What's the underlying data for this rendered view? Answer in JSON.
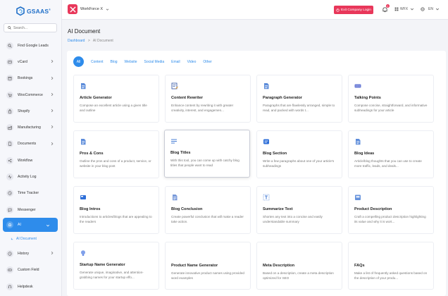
{
  "brand": {
    "name": "GSAAS",
    "mark": "®"
  },
  "search": {
    "placeholder": "Search..."
  },
  "sidebar": {
    "items": [
      {
        "label": "Find Google Leads",
        "icon": "search-icon",
        "chevron": false
      },
      {
        "label": "vCard",
        "icon": "card-icon",
        "chevron": true
      },
      {
        "label": "Bookings",
        "icon": "calendar-icon",
        "chevron": true
      },
      {
        "label": "WooCommerce",
        "icon": "cart-icon",
        "chevron": true
      },
      {
        "label": "Shopify",
        "icon": "bag-icon",
        "chevron": true
      },
      {
        "label": "Manufacturing",
        "icon": "factory-icon",
        "chevron": true
      },
      {
        "label": "Documents",
        "icon": "file-icon",
        "chevron": true
      },
      {
        "label": "Workflow",
        "icon": "share-icon",
        "chevron": false
      },
      {
        "label": "Activity Log",
        "icon": "pulse-icon",
        "chevron": false
      },
      {
        "label": "Time Tracker",
        "icon": "clock-icon",
        "chevron": false
      },
      {
        "label": "Messenger",
        "icon": "chat-icon",
        "chevron": false
      },
      {
        "label": "AI",
        "icon": "robot-icon",
        "chevron": true,
        "active": true
      }
    ],
    "sub": {
      "label": "AI Document"
    },
    "rest": [
      {
        "label": "History",
        "icon": "history-icon",
        "chevron": true
      },
      {
        "label": "Custom Field",
        "icon": "field-icon",
        "chevron": false
      },
      {
        "label": "Helpdesk",
        "icon": "headset-icon",
        "chevron": false
      }
    ]
  },
  "header": {
    "workspace": "WorkForce X",
    "exit_label": "Exit Company Login",
    "notification_count": "1",
    "org_label": "WFX",
    "lang_label": "EN"
  },
  "page": {
    "title": "AI Document",
    "breadcrumb_home": "Dashboard",
    "breadcrumb_sep": ">",
    "breadcrumb_current": "AI Document"
  },
  "tabs": [
    "All",
    "Content",
    "Blog",
    "Website",
    "Social Media",
    "Email",
    "Video",
    "Other"
  ],
  "tiles": [
    {
      "title": "Article Generator",
      "desc": "Compose an excellent article using a given title and outline",
      "icon": "document-icon",
      "color": "#4a7fd6"
    },
    {
      "title": "Content Rewriter",
      "desc": "Enhance content by rewriting it with greater creativity, interest, and engagemen...",
      "icon": "rewrite-icon",
      "color": "#3d5fa8"
    },
    {
      "title": "Paragraph Generator",
      "desc": "Paragraphs that are flawlessly arranged, simple to read, and packed with words t...",
      "icon": "paragraph-icon",
      "color": "#4a7fd6"
    },
    {
      "title": "Talking Points",
      "desc": "Compose concise, straightforward, and informative subheadings for your article",
      "icon": "talking-icon",
      "color": "#6a7bd6"
    },
    {
      "title": "Pros & Cons",
      "desc": "Outline the pros and cons of a product, service, or website in your blog post",
      "icon": "pros-cons-icon",
      "color": "#4a7fd6"
    },
    {
      "title": "Blog Titles",
      "desc": "With this tool, you can come up with catchy blog titles that people want to read",
      "icon": "blog-titles-icon",
      "color": "#4a7fd6"
    },
    {
      "title": "Blog Section",
      "desc": "Write a few paragraphs about one of your article's subheadings",
      "icon": "blog-section-icon",
      "color": "#2e6fd8"
    },
    {
      "title": "Blog Ideas",
      "desc": "Article/blog thoughts that you can use to create more traffic, leads, and deals...",
      "icon": "blog-ideas-icon",
      "color": "#4a7fd6"
    },
    {
      "title": "Blog Intros",
      "desc": "Introductions to articles/blogs that are appealing to the readers",
      "icon": "blog-intros-icon",
      "color": "#2e6fd8"
    },
    {
      "title": "Blog Conclusion",
      "desc": "Create powerful conclusion that will make a reader take action.",
      "icon": "blog-conclusion-icon",
      "color": "#6a8fd6"
    },
    {
      "title": "Summarize Text",
      "desc": "Shorten any text into a concise and easily understandable summary",
      "icon": "summarize-icon",
      "color": "#4a7fd6"
    },
    {
      "title": "Product Description",
      "desc": "Craft a compelling product description highlighting its value and why it is wort...",
      "icon": "product-icon",
      "color": "#4a7fd6"
    },
    {
      "title": "Startup Name Generator",
      "desc": "Generate unique, imaginative, and attention-grabbing names for your startup effo...",
      "icon": "bulb-icon",
      "color": "#6a8fe6"
    },
    {
      "title": "Product Name Generator",
      "desc": "Generate innovative product names using provided word examples",
      "icon": "none",
      "color": "#4a7fd6"
    },
    {
      "title": "Meta Description",
      "desc": "Based on a description, create a meta description optimized for SEO",
      "icon": "none",
      "color": "#4a7fd6"
    },
    {
      "title": "FAQs",
      "desc": "Make a list of frequently asked questions based on the description of your produ...",
      "icon": "none",
      "color": "#4a7fd6"
    }
  ],
  "colors": {
    "accent": "#2e8ceb",
    "danger": "#e8375a"
  }
}
